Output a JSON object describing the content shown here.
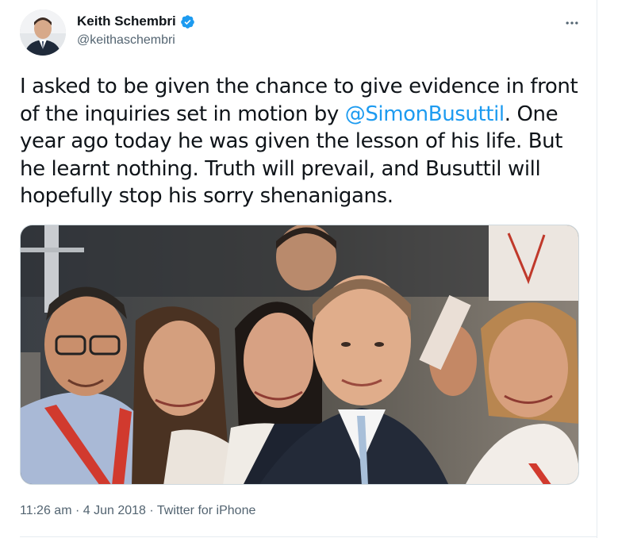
{
  "tweet": {
    "author": {
      "display_name": "Keith Schembri",
      "handle": "@keithaschembri",
      "verified": true
    },
    "text_parts": {
      "before_mention": "I asked to be given the chance to give evidence in front of the inquiries set in motion by ",
      "mention": "@SimonBusuttil",
      "after_mention": ". One year ago today he was given the lesson of his life. But he learnt nothing. Truth will prevail, and Busuttil will hopefully stop his sorry shenanigans."
    },
    "meta": {
      "time": "11:26 am",
      "separator": " · ",
      "date": "4 Jun 2018",
      "source": "Twitter for iPhone"
    }
  },
  "icons": {
    "verified": "verified-badge-icon",
    "more": "more-options-icon"
  },
  "colors": {
    "accent": "#1d9bf0",
    "text_primary": "#0f1419",
    "text_secondary": "#536471",
    "border": "#cfd9de"
  }
}
